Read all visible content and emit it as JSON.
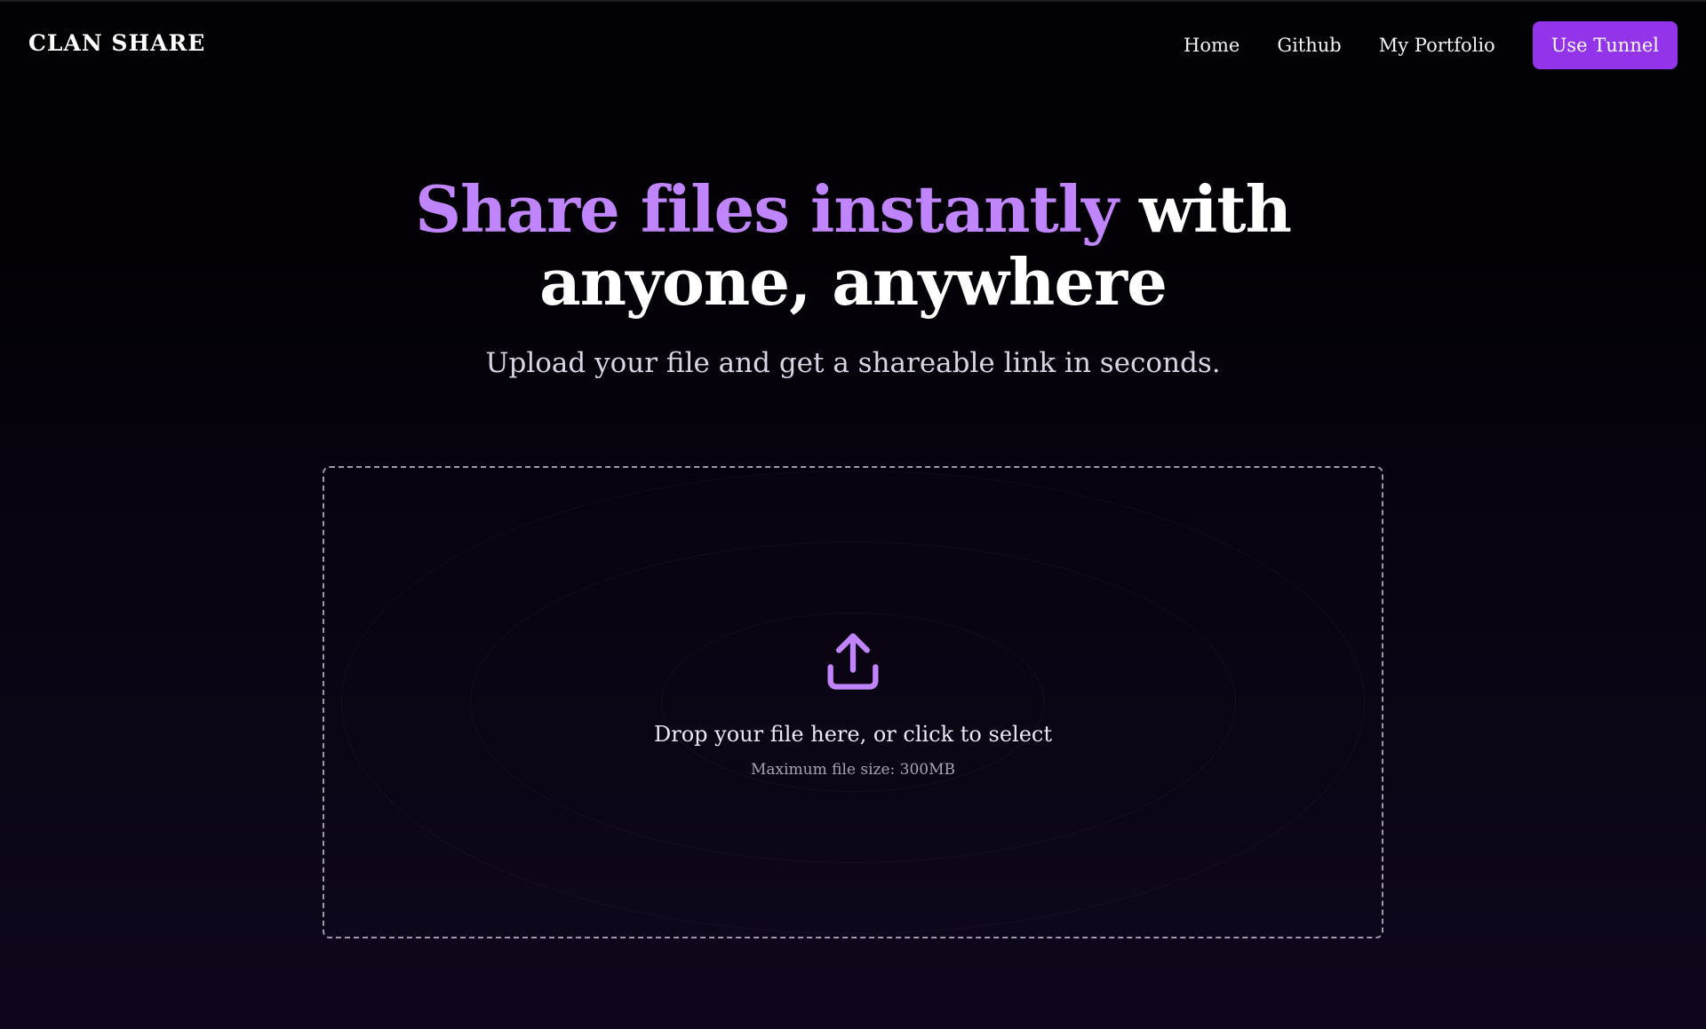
{
  "brand": "CLAN SHARE",
  "nav": {
    "links": [
      "Home",
      "Github",
      "My Portfolio"
    ],
    "cta": "Use Tunnel"
  },
  "hero": {
    "headline_accent": "Share files instantly",
    "headline_line1_rest": " with",
    "headline_line2": "anyone, anywhere",
    "subtitle": "Upload your file and get a shareable link in seconds."
  },
  "dropzone": {
    "icon": "upload-icon",
    "title": "Drop your file here, or click to select",
    "note": "Maximum file size: 300MB"
  },
  "colors": {
    "accent": "#c084fc",
    "button": "#9333ea",
    "background_top": "#020104",
    "background_bottom": "#10061c"
  }
}
